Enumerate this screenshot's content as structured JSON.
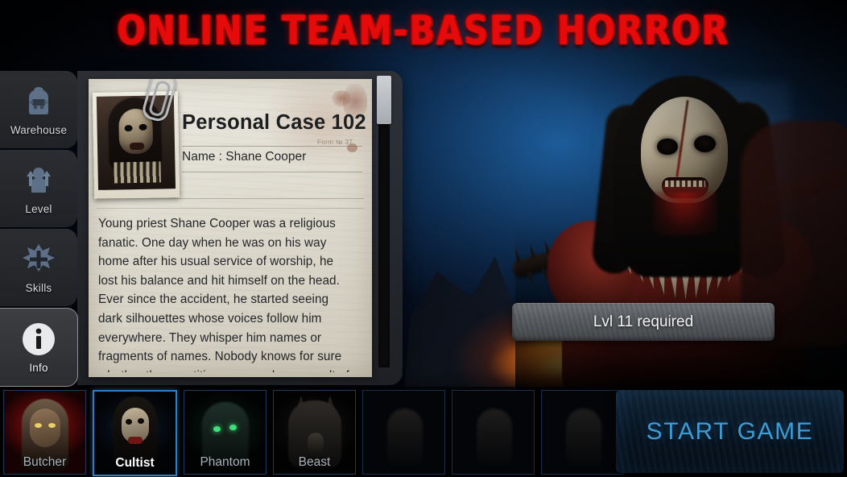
{
  "header": {
    "tagline": "ONLINE TEAM-BASED HORROR",
    "tagline_color": "#e60a0a"
  },
  "sidebar": {
    "items": [
      {
        "label": "Warehouse",
        "icon": "backpack-icon",
        "active": false
      },
      {
        "label": "Level",
        "icon": "level-up-icon",
        "active": false
      },
      {
        "label": "Skills",
        "icon": "skill-star-icon",
        "active": false
      },
      {
        "label": "Info",
        "icon": "info-circle-icon",
        "active": true
      }
    ]
  },
  "info_panel": {
    "case_title": "Personal Case 102",
    "form_number": "Form № 37",
    "name_label": "Name :",
    "name_value": "Shane Cooper",
    "name_line": "Name : Shane Cooper",
    "portrait_alt": "cultist-portrait-photo",
    "story": "Young priest Shane Cooper was a religious fanatic. One day when he was on his way home after his usual service of worship, he lost his balance and hit himself on the head. Ever since the accident, he started seeing dark silhouettes whose voices follow him everywhere. They whisper him names or fragments of names. Nobody knows for sure whether these entities appeared as a result of his head injury or if they are some kind of demonic force that possessed his consciousness. In the end, the “dark",
    "scroll_position": "top"
  },
  "level_banner": {
    "text": "Lvl 11 required"
  },
  "character_select": {
    "slots": [
      {
        "label": "Butcher",
        "state": "unlocked",
        "selected": false,
        "art": "a-butcher"
      },
      {
        "label": "Cultist",
        "state": "unlocked",
        "selected": true,
        "art": "a-cultist"
      },
      {
        "label": "Phantom",
        "state": "unlocked",
        "selected": false,
        "art": "a-phantom"
      },
      {
        "label": "Beast",
        "state": "unlocked",
        "selected": false,
        "art": "a-beast"
      },
      {
        "label": "",
        "state": "locked",
        "selected": false,
        "art": "a-locked"
      },
      {
        "label": "",
        "state": "locked",
        "selected": false,
        "art": "a-locked"
      },
      {
        "label": "",
        "state": "locked",
        "selected": false,
        "art": "a-locked"
      }
    ],
    "selected_label": "Cultist",
    "selection_color": "#2f7fc4"
  },
  "start_button": {
    "label": "START GAME",
    "text_color": "#3e9bd4"
  }
}
